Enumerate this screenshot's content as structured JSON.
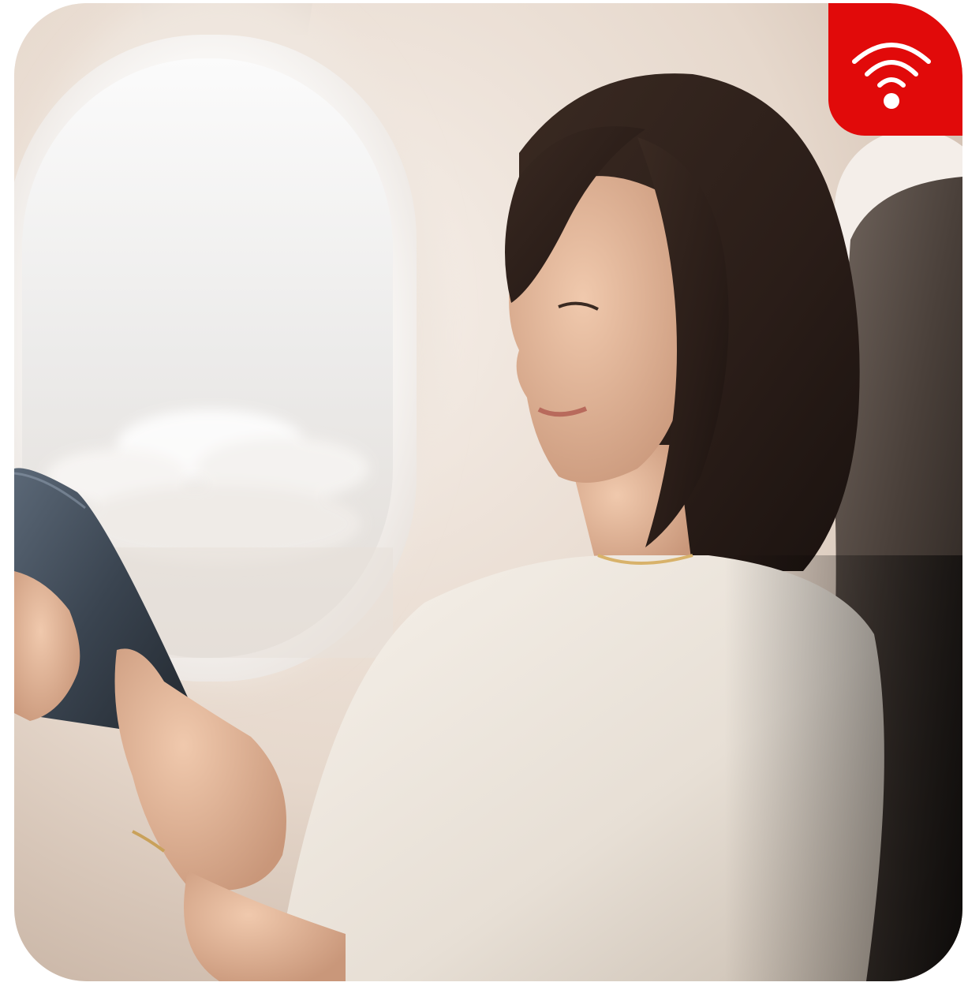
{
  "image": {
    "subject": "woman-reading-tablet-airplane-window-seat"
  },
  "badge": {
    "icon": "wifi-icon",
    "color": "#e10a0a",
    "icon_color": "#ffffff"
  }
}
